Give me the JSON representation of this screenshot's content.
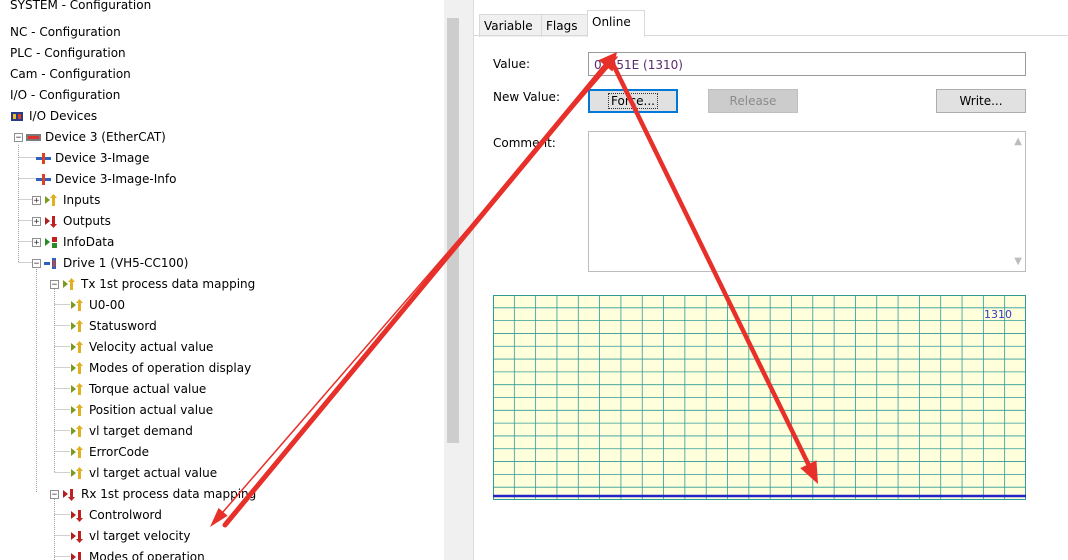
{
  "tree": {
    "items": [
      {
        "label": "SYSTEM - Configuration",
        "icon": "none"
      },
      {
        "label": "NC - Configuration",
        "icon": "none"
      },
      {
        "label": "PLC - Configuration",
        "icon": "none"
      },
      {
        "label": "Cam - Configuration",
        "icon": "none"
      },
      {
        "label": "I/O - Configuration",
        "icon": "none"
      },
      {
        "label": "I/O Devices",
        "icon": "io-devices-icon"
      },
      {
        "label": "Device 3 (EtherCAT)",
        "icon": "ethercat-device-icon",
        "toggle": "−"
      },
      {
        "label": "Device 3-Image",
        "icon": "image-icon"
      },
      {
        "label": "Device 3-Image-Info",
        "icon": "image-icon"
      },
      {
        "label": "Inputs",
        "icon": "inputs-icon",
        "toggle": "+"
      },
      {
        "label": "Outputs",
        "icon": "outputs-icon",
        "toggle": "+"
      },
      {
        "label": "InfoData",
        "icon": "infodata-icon",
        "toggle": "+"
      },
      {
        "label": "Drive 1 (VH5-CC100)",
        "icon": "drive-icon",
        "toggle": "−"
      },
      {
        "label": "Tx 1st  process data mapping",
        "icon": "input-variable-icon",
        "toggle": "−"
      },
      {
        "label": "U0-00",
        "icon": "input-variable-icon"
      },
      {
        "label": "Statusword",
        "icon": "input-variable-icon"
      },
      {
        "label": "Velocity actual value",
        "icon": "input-variable-icon"
      },
      {
        "label": "Modes of operation display",
        "icon": "input-variable-icon"
      },
      {
        "label": "Torque actual value",
        "icon": "input-variable-icon"
      },
      {
        "label": "Position actual value",
        "icon": "input-variable-icon"
      },
      {
        "label": "vl target demand",
        "icon": "input-variable-icon"
      },
      {
        "label": "ErrorCode",
        "icon": "input-variable-icon"
      },
      {
        "label": "vl target actual value",
        "icon": "input-variable-icon"
      },
      {
        "label": "Rx 1st process data mapping",
        "icon": "output-variable-icon",
        "toggle": "−"
      },
      {
        "label": "Controlword",
        "icon": "output-variable-icon"
      },
      {
        "label": "vl target velocity",
        "icon": "output-variable-icon"
      },
      {
        "label": "Modes of operation",
        "icon": "output-variable-icon"
      }
    ]
  },
  "tabs": [
    {
      "label": "Variable"
    },
    {
      "label": "Flags"
    },
    {
      "label": "Online",
      "active": true
    }
  ],
  "online": {
    "value_label": "Value:",
    "value": "0x051E (1310)",
    "new_value_label": "New Value:",
    "force_label": "Force...",
    "release_label": "Release",
    "write_label": "Write...",
    "comment_label": "Comment:",
    "comment": ""
  },
  "chart_data": {
    "type": "line",
    "series": [
      {
        "values": [
          1310,
          1310,
          1310,
          1310,
          1310,
          1310,
          1310,
          1310,
          1310,
          1310
        ]
      }
    ],
    "annotation": "1310",
    "grid": true,
    "colors": {
      "background": "#ffffdc",
      "grid": "#2f9a9a",
      "line": "#2424c8",
      "annotation": "#3a3ac8"
    }
  },
  "annotation_colors": {
    "arrow": "#e8302a"
  }
}
